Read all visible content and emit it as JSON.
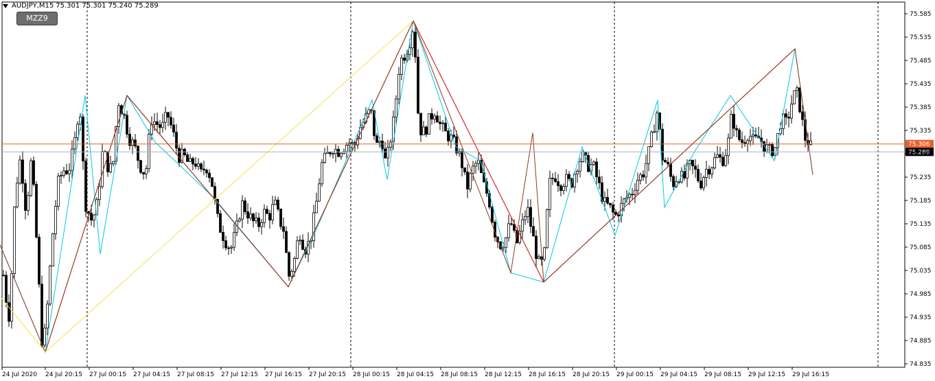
{
  "window": {
    "symbol_label": "AUDJPY,M15",
    "ohlc_label": "75.301 75.301 75.240 75.289"
  },
  "indicator_button": {
    "label": "MZZ9"
  },
  "colors": {
    "background": "#ffffff",
    "candle": "#000000",
    "grid": "#000000",
    "zigzag_cyan": "#00c8e8",
    "zigzag_red": "#cc0000",
    "zigzag_brown": "#8b3a1a",
    "zigzag_yellow": "#f4e44a",
    "price_line_orange": "#e8602c",
    "price_tag_orange": "#e8602c",
    "price_tag_dark": "#000000"
  },
  "chart_data": {
    "type": "candlestick",
    "instrument": "AUDJPY",
    "timeframe": "M15",
    "ylim": [
      74.82,
      75.58
    ],
    "y_ticks": [
      "75.585",
      "75.535",
      "75.485",
      "75.435",
      "75.385",
      "75.335",
      "75.285",
      "75.235",
      "75.185",
      "75.135",
      "75.085",
      "75.035",
      "74.985",
      "74.935",
      "74.885",
      "74.835"
    ],
    "y_tick_values": [
      75.585,
      75.535,
      75.485,
      75.435,
      75.385,
      75.335,
      75.285,
      75.235,
      75.185,
      75.135,
      75.085,
      75.035,
      74.985,
      74.935,
      74.885,
      74.835
    ],
    "x_ticks": [
      "24 Jul 2020",
      "24 Jul 20:15",
      "27 Jul 00:15",
      "27 Jul 04:15",
      "27 Jul 08:15",
      "27 Jul 12:15",
      "27 Jul 16:15",
      "27 Jul 20:15",
      "28 Jul 00:15",
      "28 Jul 04:15",
      "28 Jul 08:15",
      "28 Jul 12:15",
      "28 Jul 16:15",
      "28 Jul 20:15",
      "29 Jul 00:15",
      "29 Jul 04:15",
      "29 Jul 08:15",
      "29 Jul 12:15",
      "29 Jul 16:15"
    ],
    "price_tags": [
      {
        "label": "75.306",
        "value": 75.306,
        "style": "orange"
      },
      {
        "label": "75.289",
        "value": 75.289,
        "style": "dark"
      }
    ],
    "anchors": [
      [
        0,
        75.15
      ],
      [
        6,
        75.0
      ],
      [
        14,
        74.93
      ],
      [
        22,
        75.2
      ],
      [
        30,
        75.28
      ],
      [
        38,
        75.16
      ],
      [
        46,
        75.28
      ],
      [
        54,
        75.08
      ],
      [
        62,
        74.86
      ],
      [
        68,
        74.94
      ],
      [
        76,
        75.1
      ],
      [
        84,
        75.22
      ],
      [
        92,
        75.25
      ],
      [
        100,
        75.25
      ],
      [
        108,
        75.3
      ],
      [
        116,
        75.4
      ],
      [
        124,
        75.18
      ],
      [
        134,
        75.14
      ],
      [
        142,
        75.18
      ],
      [
        150,
        75.3
      ],
      [
        156,
        75.26
      ],
      [
        164,
        75.25
      ],
      [
        172,
        75.4
      ],
      [
        180,
        75.37
      ],
      [
        188,
        75.32
      ],
      [
        196,
        75.3
      ],
      [
        204,
        75.26
      ],
      [
        212,
        75.24
      ],
      [
        220,
        75.36
      ],
      [
        228,
        75.35
      ],
      [
        236,
        75.34
      ],
      [
        244,
        75.37
      ],
      [
        252,
        75.33
      ],
      [
        260,
        75.28
      ],
      [
        268,
        75.28
      ],
      [
        276,
        75.26
      ],
      [
        284,
        75.27
      ],
      [
        292,
        75.24
      ],
      [
        300,
        75.26
      ],
      [
        308,
        75.23
      ],
      [
        316,
        75.15
      ],
      [
        322,
        75.12
      ],
      [
        328,
        75.1
      ],
      [
        336,
        75.08
      ],
      [
        344,
        75.12
      ],
      [
        352,
        75.18
      ],
      [
        360,
        75.16
      ],
      [
        368,
        75.14
      ],
      [
        376,
        75.13
      ],
      [
        384,
        75.16
      ],
      [
        392,
        75.15
      ],
      [
        400,
        75.18
      ],
      [
        408,
        75.14
      ],
      [
        414,
        75.12
      ],
      [
        420,
        75.02
      ],
      [
        428,
        75.05
      ],
      [
        436,
        75.12
      ],
      [
        444,
        75.08
      ],
      [
        452,
        75.1
      ],
      [
        460,
        75.17
      ],
      [
        468,
        75.26
      ],
      [
        476,
        75.28
      ],
      [
        484,
        75.3
      ],
      [
        492,
        75.29
      ],
      [
        500,
        75.3
      ],
      [
        508,
        75.31
      ],
      [
        516,
        75.3
      ],
      [
        524,
        75.34
      ],
      [
        532,
        75.36
      ],
      [
        540,
        75.38
      ],
      [
        548,
        75.3
      ],
      [
        556,
        75.32
      ],
      [
        562,
        75.26
      ],
      [
        568,
        75.31
      ],
      [
        574,
        75.36
      ],
      [
        582,
        75.48
      ],
      [
        590,
        75.5
      ],
      [
        596,
        75.52
      ],
      [
        602,
        75.56
      ],
      [
        606,
        75.48
      ],
      [
        610,
        75.34
      ],
      [
        618,
        75.33
      ],
      [
        626,
        75.36
      ],
      [
        634,
        75.38
      ],
      [
        640,
        75.35
      ],
      [
        648,
        75.33
      ],
      [
        656,
        75.32
      ],
      [
        664,
        75.3
      ],
      [
        672,
        75.27
      ],
      [
        680,
        75.21
      ],
      [
        688,
        75.25
      ],
      [
        696,
        75.27
      ],
      [
        704,
        75.22
      ],
      [
        712,
        75.19
      ],
      [
        720,
        75.12
      ],
      [
        728,
        75.09
      ],
      [
        736,
        75.1
      ],
      [
        744,
        75.14
      ],
      [
        752,
        75.09
      ],
      [
        760,
        75.13
      ],
      [
        768,
        75.17
      ],
      [
        776,
        75.11
      ],
      [
        784,
        75.05
      ],
      [
        792,
        75.05
      ],
      [
        800,
        75.22
      ],
      [
        808,
        75.24
      ],
      [
        816,
        75.22
      ],
      [
        824,
        75.23
      ],
      [
        832,
        75.22
      ],
      [
        840,
        75.26
      ],
      [
        848,
        75.28
      ],
      [
        856,
        75.26
      ],
      [
        864,
        75.26
      ],
      [
        872,
        75.22
      ],
      [
        880,
        75.18
      ],
      [
        888,
        75.17
      ],
      [
        896,
        75.15
      ],
      [
        904,
        75.17
      ],
      [
        912,
        75.19
      ],
      [
        920,
        75.2
      ],
      [
        928,
        75.23
      ],
      [
        936,
        75.24
      ],
      [
        944,
        75.28
      ],
      [
        952,
        75.34
      ],
      [
        958,
        75.38
      ],
      [
        964,
        75.28
      ],
      [
        972,
        75.26
      ],
      [
        980,
        75.22
      ],
      [
        988,
        75.24
      ],
      [
        996,
        75.23
      ],
      [
        1004,
        75.26
      ],
      [
        1012,
        75.25
      ],
      [
        1020,
        75.22
      ],
      [
        1028,
        75.25
      ],
      [
        1036,
        75.26
      ],
      [
        1044,
        75.28
      ],
      [
        1052,
        75.27
      ],
      [
        1060,
        75.3
      ],
      [
        1066,
        75.37
      ],
      [
        1074,
        75.32
      ],
      [
        1082,
        75.31
      ],
      [
        1090,
        75.33
      ],
      [
        1098,
        75.31
      ],
      [
        1106,
        75.32
      ],
      [
        1114,
        75.3
      ],
      [
        1122,
        75.29
      ],
      [
        1130,
        75.3
      ],
      [
        1138,
        75.36
      ],
      [
        1146,
        75.35
      ],
      [
        1154,
        75.4
      ],
      [
        1160,
        75.42
      ],
      [
        1166,
        75.38
      ],
      [
        1172,
        75.32
      ],
      [
        1178,
        75.31
      ],
      [
        1184,
        75.29
      ]
    ],
    "zigzags": [
      {
        "color": "zigzag_cyan",
        "points": [
          [
            0,
            75.09
          ],
          [
            66,
            74.86
          ],
          [
            124,
            75.41
          ],
          [
            146,
            75.07
          ],
          [
            185,
            75.41
          ],
          [
            226,
            75.31
          ],
          [
            312,
            75.19
          ],
          [
            420,
            75.0
          ],
          [
            460,
            75.12
          ],
          [
            542,
            75.4
          ],
          [
            564,
            75.23
          ],
          [
            602,
            75.57
          ],
          [
            664,
            75.3
          ],
          [
            700,
            75.27
          ],
          [
            744,
            75.03
          ],
          [
            792,
            75.01
          ],
          [
            848,
            75.3
          ],
          [
            896,
            75.11
          ],
          [
            958,
            75.4
          ],
          [
            968,
            75.17
          ],
          [
            1012,
            75.29
          ],
          [
            1064,
            75.41
          ],
          [
            1128,
            75.27
          ],
          [
            1158,
            75.51
          ],
          [
            1184,
            75.24
          ]
        ]
      },
      {
        "color": "zigzag_red",
        "points": [
          [
            66,
            74.86
          ],
          [
            185,
            75.41
          ],
          [
            420,
            75.0
          ],
          [
            602,
            75.57
          ],
          [
            792,
            75.01
          ],
          [
            1158,
            75.51
          ]
        ]
      },
      {
        "color": "zigzag_brown",
        "points": [
          [
            0,
            75.09
          ],
          [
            66,
            74.86
          ],
          [
            185,
            75.41
          ],
          [
            420,
            75.0
          ],
          [
            602,
            75.57
          ],
          [
            744,
            75.03
          ],
          [
            776,
            75.33
          ],
          [
            792,
            75.01
          ],
          [
            1158,
            75.51
          ],
          [
            1184,
            75.24
          ]
        ]
      },
      {
        "color": "zigzag_yellow",
        "points": [
          [
            0,
            74.98
          ],
          [
            66,
            74.86
          ],
          [
            602,
            75.57
          ]
        ]
      }
    ]
  }
}
